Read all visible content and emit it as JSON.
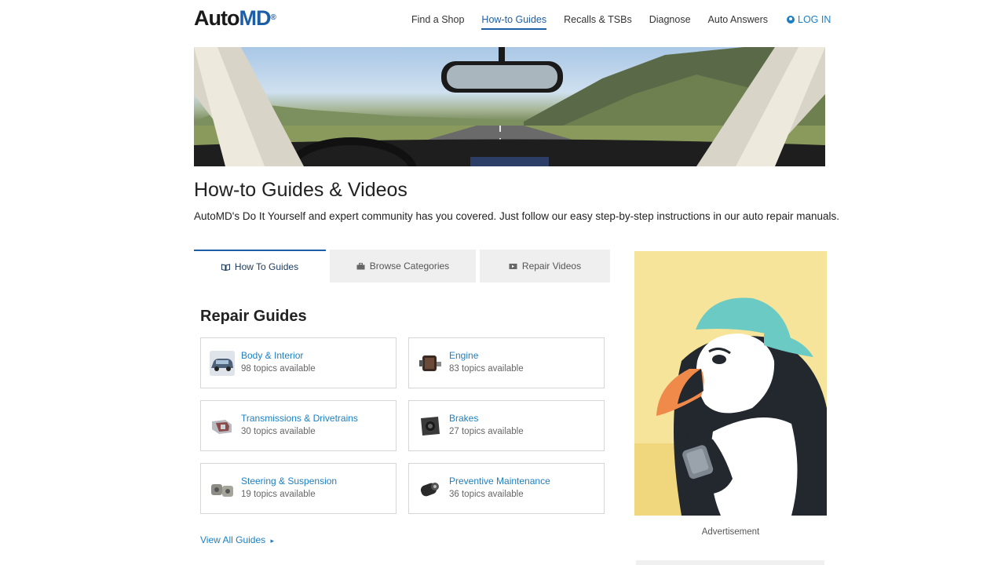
{
  "logo": {
    "part1": "Auto",
    "part2": "MD",
    "mark": "®"
  },
  "nav": {
    "items": [
      {
        "label": "Find a Shop",
        "active": false
      },
      {
        "label": "How-to Guides",
        "active": true
      },
      {
        "label": "Recalls & TSBs",
        "active": false
      },
      {
        "label": "Diagnose",
        "active": false
      },
      {
        "label": "Auto Answers",
        "active": false
      }
    ],
    "login_label": "LOG IN",
    "login_icon": "user-circle-icon"
  },
  "page": {
    "title": "How-to Guides & Videos",
    "subtitle": "AutoMD's Do It Yourself and expert community has you covered. Just follow our easy step-by-step instructions in our auto repair manuals."
  },
  "tabs": [
    {
      "label": "How To Guides",
      "icon": "book-icon",
      "active": true
    },
    {
      "label": "Browse Categories",
      "icon": "toolbox-icon",
      "active": false
    },
    {
      "label": "Repair Videos",
      "icon": "video-icon",
      "active": false
    }
  ],
  "repair_guides": {
    "title": "Repair Guides",
    "cards": [
      {
        "title": "Body & Interior",
        "subtitle": "98 topics available",
        "icon": "car-body-icon"
      },
      {
        "title": "Engine",
        "subtitle": "83 topics available",
        "icon": "engine-icon"
      },
      {
        "title": "Transmissions & Drivetrains",
        "subtitle": "30 topics available",
        "icon": "transmission-icon"
      },
      {
        "title": "Brakes",
        "subtitle": "27 topics available",
        "icon": "brake-icon"
      },
      {
        "title": "Steering & Suspension",
        "subtitle": "19 topics available",
        "icon": "suspension-icon"
      },
      {
        "title": "Preventive Maintenance",
        "subtitle": "36 topics available",
        "icon": "filter-icon"
      }
    ],
    "view_all_label": "View All Guides",
    "view_all_arrow": "▸"
  },
  "ad": {
    "label": "Advertisement"
  },
  "colors": {
    "brand_blue": "#1d5fa6",
    "link_blue": "#1d7fc1",
    "ad_bg": "#f6e49a"
  }
}
